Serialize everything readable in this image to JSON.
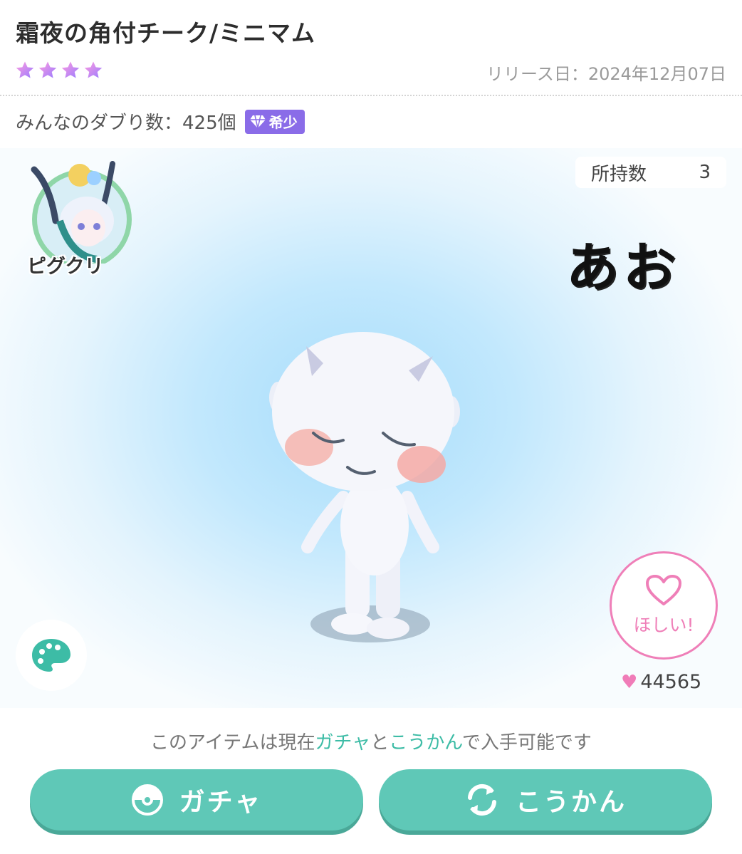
{
  "item": {
    "title": "霜夜の角付チーク/ミニマム",
    "rarity_stars": 4,
    "release_label": "リリース日：2024年12月07日",
    "duplicate_label": "みんなのダブり数：425個",
    "rare_badge": "希少"
  },
  "stage": {
    "owned_label": "所持数",
    "owned_count": "3",
    "creator_name": "ピグクリ",
    "handwriting": "あお"
  },
  "want": {
    "label": "ほしい!",
    "count": "44565"
  },
  "availability": {
    "prefix": "このアイテムは現在",
    "gacha": "ガチャ",
    "and": "と",
    "exchange": "こうかん",
    "suffix": "で入手可能です"
  },
  "buttons": {
    "gacha_label": "ガチャ",
    "exchange_label": "こうかん"
  },
  "colors": {
    "accent_teal": "#5fc8b7",
    "heart_pink": "#ef7fb8",
    "rare_purple": "#8a6ce8"
  },
  "icons": [
    "star-icon",
    "diamond-icon",
    "palette-icon",
    "heart-icon",
    "gacha-icon",
    "exchange-icon"
  ]
}
